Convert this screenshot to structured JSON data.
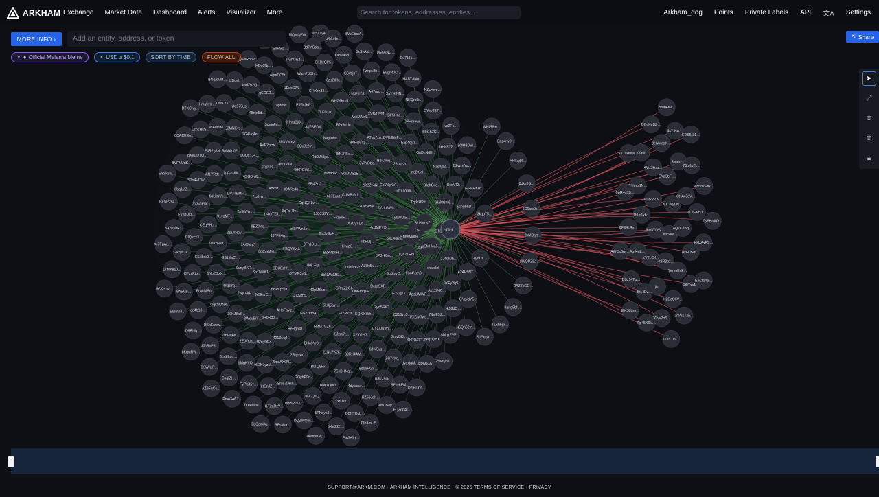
{
  "app": {
    "name": "ARKHAM"
  },
  "nav": {
    "left": [
      "Exchange",
      "Market Data",
      "Dashboard",
      "Alerts",
      "Visualizer",
      "More"
    ],
    "right": [
      "Arkham_dog",
      "Points",
      "Private Labels",
      "API"
    ],
    "settings": "Settings"
  },
  "search": {
    "placeholder": "Search for tokens, addresses, entities..."
  },
  "visualizer": {
    "more_info": "MORE INFO",
    "entity_placeholder": "Add an entity, address, or token",
    "share": "Share",
    "center_label": "offici…"
  },
  "filters": {
    "melania": "Official Melania Meme",
    "usd": "USD ≥ $0.1",
    "sort": "SORT BY TIME",
    "flow": "FLOW ALL"
  },
  "toolbar": {
    "icons": [
      "pointer-icon",
      "fit-screen-icon",
      "zoom-in-icon",
      "zoom-out-icon",
      "lock-icon"
    ]
  },
  "colors": {
    "inflow": "#5fae63",
    "outflow": "#d9545c",
    "node": "#2a2d35",
    "accent": "#2563eb"
  },
  "footer": {
    "text": "SUPPORT@ARKM.COM · ARKHAM INTELLIGENCE · © 2025  TERMS OF SERVICE · PRIVACY"
  },
  "graph": {
    "left_nodes": [
      "GaJvGoH…",
      "3Fn1B1z…",
      "9JQ2S9V…",
      "BZK4bnH…",
      "b6kYWn5e…",
      "FvzimR…",
      "8uiLXig…",
      "CqNQXLw…",
      "Hrwp8…",
      "H3QYYvU…",
      "6L7Eaut…",
      "dbNWAMS…",
      "3qFaHJv…",
      "A7CyYDh…",
      "DYMR3yS…",
      "SP4GoJ…",
      "coinbase",
      "1J7FE4q…",
      "CUM5oN1…",
      "40pMSux…",
      "BDARc4b…",
      "6tbFLtj…",
      "CBUEzhh…",
      "Y9da8jP…",
      "SRmZ2Gb…",
      "o4kyTZJ…",
      "2LscVbN…",
      "DT32m5…",
      "9tKPGWl…",
      "A3UcBu…",
      "6G2mMYi…",
      "9GMDS1B…",
      "5L8j5ay…",
      "4bxpz…",
      "4gJMPYQ…",
      "BBRLpSD…",
      "RdDWdgo…",
      "DbGmqKE…",
      "8EZJvtq…",
      "2RZZv4N…",
      "EGz7kmA…",
      "4t2YkaN…",
      "8P3vkBn…",
      "9zDWritJ…",
      "8tNJFSv…",
      "Fx7RZst…",
      "7zzfyw…",
      "6V2LGWo…",
      "AHbFaVz…",
      "5QyJz2m…",
      "DczzSXF…",
      "2S9ZvqQ…",
      "3v7YDbo…",
      "FMM7GZ6…",
      "cryptoc…",
      "5EL4GYy…",
      "Jx5EcrC…",
      "Nagtoho…",
      "EQXiKWh…",
      "2p9tVNn…",
      "GsVdgXV…",
      "BeRgh41…",
      "3LGVMxV…",
      "SgfZvvQ…",
      "9unyBKR…",
      "9XPeMYp…",
      "5Jxm7t…",
      "4SGDrd0…",
      "7DCnh24…",
      "BHoRdo…",
      "Ag7BEDX…",
      "7yoSRtC…",
      "ZpLhNbv…",
      "B2iLVoq…",
      "BHo9Yr3…",
      "AVE2hcw…",
      "DQa2TRm…",
      "2wyo3dz…",
      "B2x3oUc…",
      "X2Vt2H7…",
      "DVJTEMF…",
      "ZbYcmW…",
      "4213wqJ…",
      "9HmgBjQ…",
      "FJV9jsX…",
      "GS1EaCj…",
      "ATgq7zu…",
      "21NLPKG…",
      "D3QsTJ4…",
      "Yotv1AS…",
      "3WduBiY…",
      "7LChdzc…",
      "CYzXWWy…",
      "91vqMT…",
      "23bqz2c…",
      "2Rtypwc…",
      "5dmqInt…",
      "HM4Yzh3…",
      "4nqz3q…",
      "AxnMAeS…",
      "B9RX4AM…",
      "7pCzuAk…",
      "TqdsHPd…",
      "BFYgDEo…",
      "P97kJK8…",
      "C316vh5…",
      "9kaz6Nb…",
      "DVBJNcF…",
      "BtTQ9Fx…",
      "2G4Vo4e…",
      "BF5Qfrl…",
      "39KJ8a3…",
      "WHZ9Km5…",
      "6jNk5yg…",
      "60LkSVu…",
      "Hne2Kx9…",
      "5mxAX9N…",
      "aphold",
      "ApsUMWP…",
      "BNbZGxX…",
      "2VRrNVM…",
      "7SxBHNq…",
      "5pMAo02…",
      "1ybWDt5…",
      "2EiXYzc…",
      "GHXzh33…",
      "6ysvGKL…",
      "CEqPHc…",
      "Eap4oy0…",
      "2QybP9c…",
      "48njo5d…",
      "wavelot",
      "GqkSONX…",
      "21CE6YS…",
      "5db6RGY…",
      "Af1YRde…",
      "GIqhGvd…",
      "6DN7yzM…",
      "HFvnG25…",
      "FXCM7wa…",
      "ESv8oa3…",
      "BF5Hrjc…",
      "BhKzQdD…",
      "E3MNKys…",
      "EM9WkAR…",
      "33BHqAK…",
      "6ps2tkh…",
      "2C7vXo…",
      "3V8GE5t…",
      "GnDzNdE…",
      "Sm67DRh…",
      "gCGE2…",
      "Ak12F66…",
      "FtwcMSo…",
      "A47racl…",
      "4dyweur…",
      "F4R2g8N…",
      "HaNGm6…",
      "8jMgKVQ…",
      "Wam7USh…",
      "6hPRZFT…",
      "CIQecx3…",
      "DPHnrewr…",
      "LnLCQaQ…",
      "Da575us…",
      "2J4okJh…",
      "DKnEoww…",
      "G6vbjsT…",
      "B5Kz5Gt…",
      "S2o4HDW…",
      "Nzs4jbZ…",
      "LtSnJZ…",
      "AgmDC5t…",
      "7IbcE5J…",
      "CPzsRtb…",
      "XaYHfNN…",
      "7Yx5Jsx…",
      "ABEibSM…",
      "BLHMcsZ…",
      "BceZLpc…",
      "GKBzQP5…",
      "dyaxjgM…",
      "FVkdUkr…",
      "S6t1hZC…",
      "MN5Pv1T…",
      "4wdZn2Q…",
      "9KFyYqS…",
      "ee4b13…",
      "Fwnpk8h…",
      "HZ56JqX…",
      "BKeDDTO…",
      "HroNT3…",
      "FyPkX5y…",
      "7rwhGE2…",
      "8kqzQmX…",
      "32kqW3x…",
      "NHQro9x…",
      "5PNsya8…",
      "DbfKYT…",
      "vSMH4a5…",
      "ATtSbP3…",
      "DPNA6p…",
      "SFhHtEN…",
      "6bq1YZ…",
      "8xeN5TZ…",
      "GT2aRzY…",
      "HDo3Np…",
      "Ht59dQ…",
      "9A5M9…",
      "5Vgn4JC…",
      "DBNTDkb…",
      "CshsHkS…",
      "ychgbhD…",
      "BkqlZt…",
      "Bd7YGap…",
      "FPbNwh…",
      "6Ap75dk…",
      "2Yov8B7…",
      "DQZWQvs…",
      "b1tget",
      "A24H5NT…",
      "D9Rhfq…",
      "5xSvAid…",
      "Vso7B8y…",
      "BVFNUdS…",
      "C2vzmYp…",
      "bbwdnbc…",
      "EnR9Ip…",
      "SMqkZVE…",
      "DrMX81J…",
      "HAB7SNq…",
      "5Xe8821…",
      "Hmgkylc…",
      "DT3fpHv…",
      "G9WIUP…",
      "CFNbNe…",
      "D7jRDbs…",
      "BFSR254…",
      "vs2Fk…",
      "BEsMar…",
      "DyFaRdnP…",
      "CYzvdY5…",
      "E9rmnJ…",
      "9Gf9vNQ…",
      "7JpAmU5…",
      "6QACKEq…",
      "GSMFX1q…",
      "Pmn3A6J…",
      "MQMQFW…",
      "GSKcyhk…",
      "9c7FpAu…",
      "NZcHwe…",
      "Dramw3q…",
      "BGqalVM…",
      "4y8Ctl…",
      "8KqvjRW…",
      "8VvEbaV…",
      "FQZqbAU…",
      "EYSkJhl…",
      "8QM3DVr…",
      "GLCem3q…",
      "7dtQKm…",
      "N6Qn62m…",
      "5CKecw…",
      "Cu71J1…",
      "Em3e3q…",
      "DTKCIvy…",
      "3kqb75…",
      "AZ9FqCc…",
      "9u5T1y4…"
    ],
    "right_nodes": [
      "6elsSez…",
      "9mSTueV…",
      "3UCMyQq…",
      "Ht8R8bz…",
      "9TuZZZw…",
      "4Q7CuBq…",
      "HZV2LCK…",
      "EYpSbFi…",
      "9emuEdk…",
      "1bLc1kb…",
      "CKAc3dV…",
      "jito",
      "4VqSkoa…",
      "Ak6LzPn…",
      "AgJ4uL…",
      "5txabz…",
      "H2EoQ6V…",
      "DbhnuSN…",
      "7CsEKcDj…",
      "BtLiiEv…",
      "8eNMozX…",
      "Bj8Yvs1…",
      "9FE4LRx…",
      "75gKqZc…",
      "8Gvv2oS…",
      "2LnYa6b…",
      "HHzAyFS…",
      "DBz14Tg…",
      "4sYtHA…",
      "2mG1Tzn…",
      "6wR4q1B…",
      "Ann8ZEfR…",
      "Fp45X6V…",
      "BCuKeBZ…",
      "EaCt14p…",
      "AWQs6ny…",
      "EDS5r31…",
      "1TJ5J19…",
      "9Y1cHmw…",
      "Dy6HnAQ…",
      "EHS8Lsx…",
      "2iYa49N…"
    ],
    "mid_nodes": [
      "WHIS6m…",
      "Eap4ny0…",
      "HHvZjpt…",
      "6dkz3S…",
      "5C6aw9s…",
      "8vMDtyt…",
      "8WQPZEz…",
      "DAZ7kGO…",
      "9ang8bh…",
      "TLxhFja…",
      "5bFxpyr…"
    ]
  }
}
